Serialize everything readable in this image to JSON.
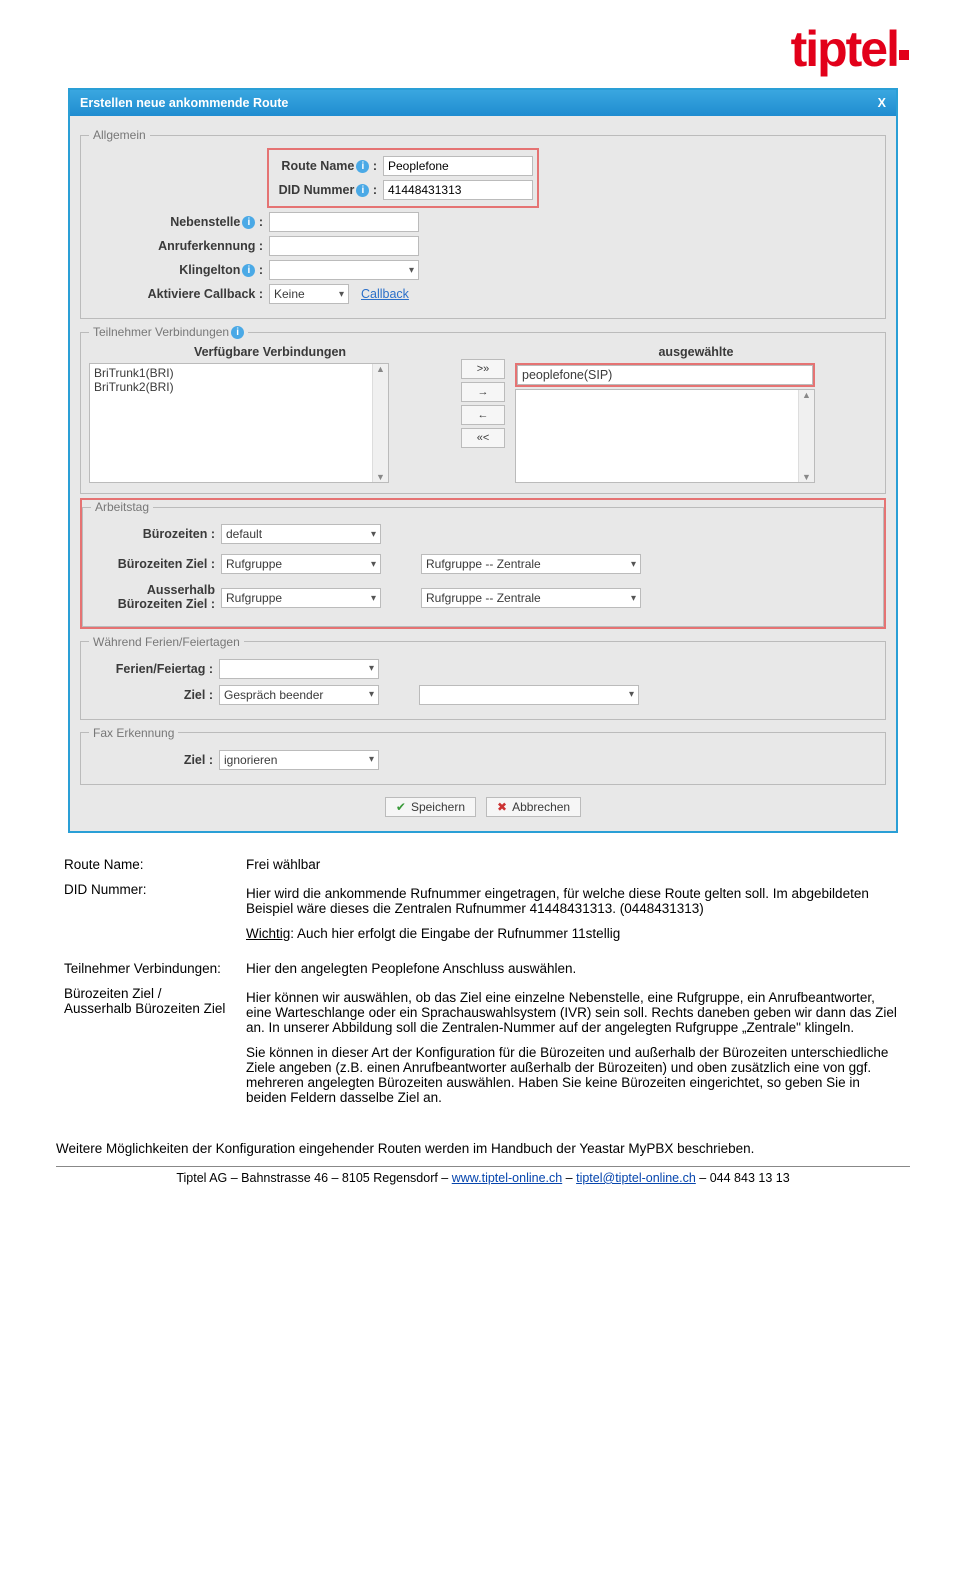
{
  "brand": "tiptel",
  "dialog": {
    "title": "Erstellen neue ankommende Route",
    "close": "X",
    "fs_allgemein": "Allgemein",
    "route_name_label": "Route Name",
    "route_name_value": "Peoplefone",
    "did_label": "DID Nummer",
    "did_value": "41448431313",
    "nebenstelle_label": "Nebenstelle",
    "anruferk_label": "Anruferkennung",
    "klingelton_label": "Klingelton",
    "callback_label": "Aktiviere Callback :",
    "callback_value": "Keine",
    "callback_link": "Callback",
    "fs_teilnehmer": "Teilnehmer Verbindungen",
    "col_avail": "Verfügbare Verbindungen",
    "col_sel": "ausgewählte",
    "avail_items": [
      "BriTrunk1(BRI)",
      "BriTrunk2(BRI)"
    ],
    "sel_item": "peoplefone(SIP)",
    "btn_allr": ">»",
    "btn_r": "→",
    "btn_l": "←",
    "btn_alll": "«<",
    "fs_arbeitstag": "Arbeitstag",
    "buerozeiten_label": "Bürozeiten :",
    "buerozeiten_val": "default",
    "buerozeiten_ziel_label": "Bürozeiten Ziel :",
    "ausser_label_l1": "Ausserhalb",
    "ausser_label_l2": "Bürozeiten Ziel :",
    "rufgruppe": "Rufgruppe",
    "rufgruppe_zentrale": "Rufgruppe -- Zentrale",
    "fs_ferien": "Während Ferien/Feiertagen",
    "ferien_label": "Ferien/Feiertag :",
    "ziel_label": "Ziel :",
    "gespraech_beenden": "Gespräch beender",
    "fs_fax": "Fax Erkennung",
    "fax_ziel_label": "Ziel :",
    "ignorieren": "ignorieren",
    "save": "Speichern",
    "cancel": "Abbrechen"
  },
  "desc": {
    "route_name_l": "Route Name:",
    "route_name_v": "Frei wählbar",
    "did_l": "DID Nummer:",
    "did_v1": "Hier wird die ankommende Rufnummer eingetragen, für welche diese Route gelten soll. Im abgebildeten Beispiel wäre dieses die Zentralen Rufnummer 41448431313. (0448431313)",
    "did_wichtig": "Wichtig",
    "did_v2": ": Auch hier erfolgt die Eingabe der Rufnummer 11stellig",
    "teilnehmer_l": "Teilnehmer Verbindungen:",
    "teilnehmer_v": "Hier den angelegten Peoplefone Anschluss auswählen.",
    "buero_l": "Bürozeiten Ziel / Ausserhalb Bürozeiten Ziel",
    "buero_v1": "Hier können wir auswählen, ob das Ziel eine einzelne Nebenstelle, eine Rufgruppe, ein Anrufbeantworter, eine Warteschlange oder ein Sprachauswahlsystem (IVR) sein soll. Rechts daneben geben wir dann das Ziel an. In unserer Abbildung soll die Zentralen-Nummer auf der angelegten Rufgruppe „Zentrale\" klingeln.",
    "buero_v2": "Sie können in dieser Art der Konfiguration für die Bürozeiten und außerhalb der Bürozeiten unterschiedliche Ziele angeben (z.B. einen Anrufbeantworter außerhalb der Bürozeiten) und oben zusätzlich eine von ggf. mehreren angelegten Bürozeiten auswählen. Haben Sie keine Bürozeiten eingerichtet, so geben Sie in beiden Feldern dasselbe Ziel an.",
    "weitere": "Weitere Möglichkeiten der Konfiguration eingehender Routen werden im Handbuch der Yeastar MyPBX beschrieben."
  },
  "footer": {
    "text1": "Tiptel AG – Bahnstrasse 46 – 8105 Regensdorf – ",
    "link1": "www.tiptel-online.ch",
    "dash": " – ",
    "link2": "tiptel@tiptel-online.ch",
    "text2": " – 044 843 13 13"
  }
}
